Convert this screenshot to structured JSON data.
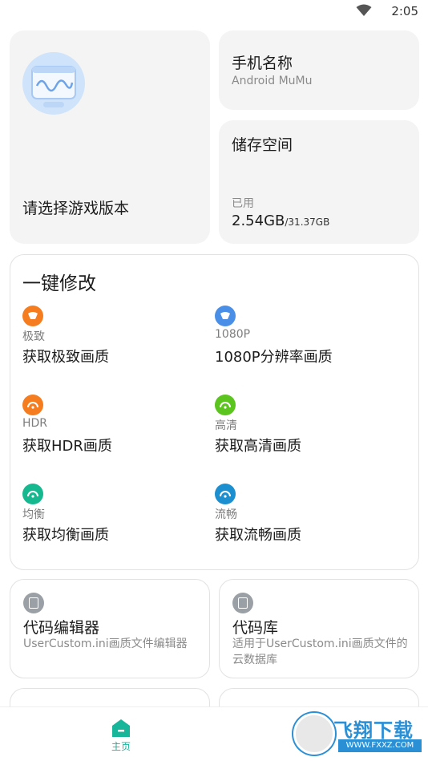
{
  "status_bar": {
    "time": "2:05"
  },
  "game_card": {
    "label": "请选择游戏版本"
  },
  "phone_card": {
    "title": "手机名称",
    "value": "Android MuMu"
  },
  "storage_card": {
    "title": "储存空间",
    "used_label": "已用",
    "used": "2.54GB",
    "total": "/31.37GB"
  },
  "quick_modify": {
    "title": "一键修改",
    "options": [
      {
        "tag": "极致",
        "name": "获取极致画质",
        "color": "#f57c1f"
      },
      {
        "tag": "1080P",
        "name": "1080P分辨率画质",
        "color": "#4a8fe7"
      },
      {
        "tag": "HDR",
        "name": "获取HDR画质",
        "color": "#f57c1f"
      },
      {
        "tag": "高清",
        "name": "获取高清画质",
        "color": "#5cc41e"
      },
      {
        "tag": "均衡",
        "name": "获取均衡画质",
        "color": "#15b88f"
      },
      {
        "tag": "流畅",
        "name": "获取流畅画质",
        "color": "#1c8fd0"
      }
    ]
  },
  "tools": [
    {
      "name": "代码编辑器",
      "desc": "UserCustom.ini画质文件编辑器",
      "icon": "file-e-icon"
    },
    {
      "name": "代码库",
      "desc": "适用于UserCustom.ini画质文件的云数据库",
      "icon": "file-w-icon"
    }
  ],
  "bottom_nav": {
    "home_label": "主页",
    "accent": "#17b59a"
  },
  "watermark": {
    "text": "飞翔下载",
    "url": "WWW.FXXZ.COM"
  }
}
